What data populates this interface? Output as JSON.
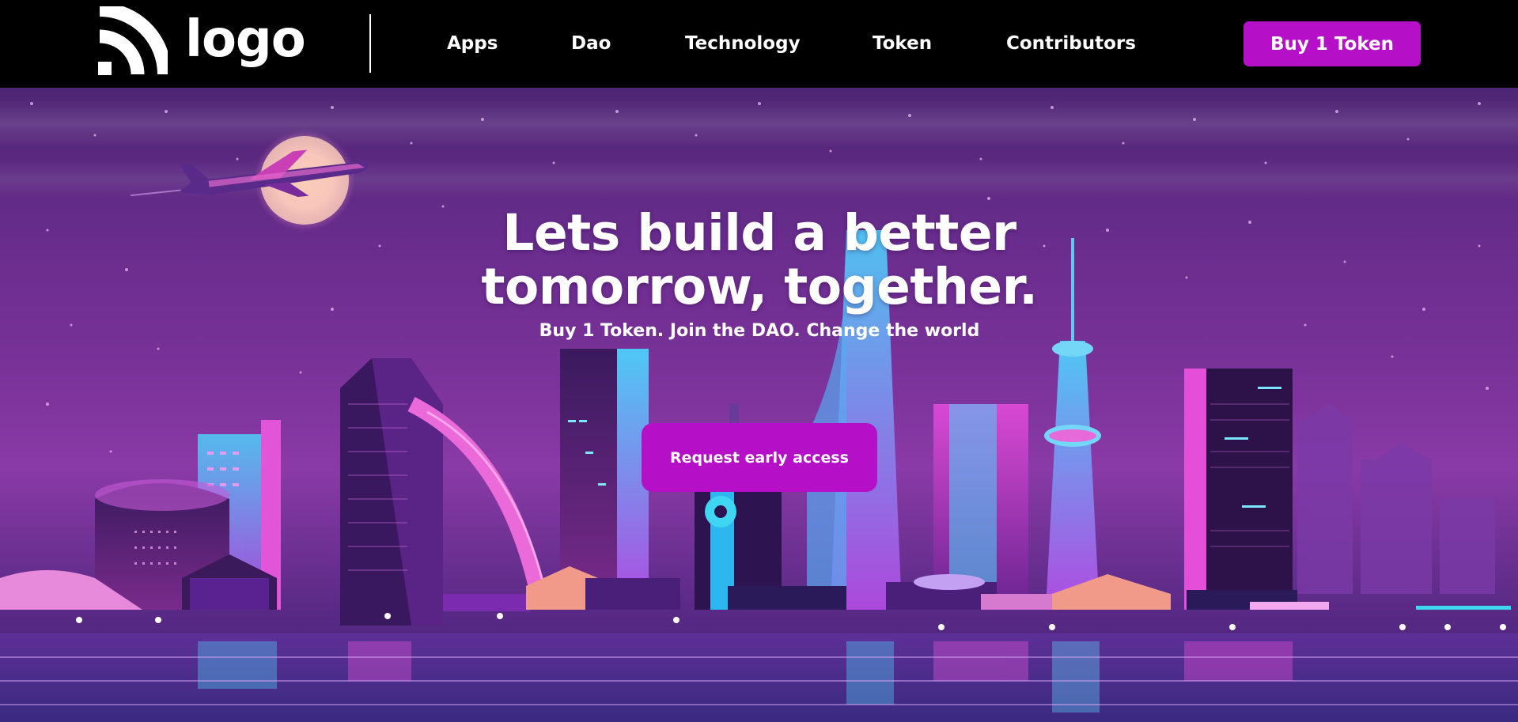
{
  "header": {
    "logo_text": "logo",
    "nav": [
      {
        "label": "Apps"
      },
      {
        "label": "Dao"
      },
      {
        "label": "Technology"
      },
      {
        "label": "Token"
      },
      {
        "label": "Contributors"
      }
    ],
    "buy_button_label": "Buy 1 Token"
  },
  "hero": {
    "title_line1": "Lets build a better",
    "title_line2": "tomorrow, together.",
    "subtitle": "Buy 1 Token. Join the DAO. Change the world",
    "cta_label": "Request early access"
  },
  "colors": {
    "accent": "#b50fc8",
    "nav_background": "#000000",
    "sky": "#6a2d8e",
    "neon_cyan": "#3fd6f2",
    "neon_pink": "#e83ad8"
  },
  "icons": {
    "logo_mark": "wifi-arcs-logo-icon"
  }
}
